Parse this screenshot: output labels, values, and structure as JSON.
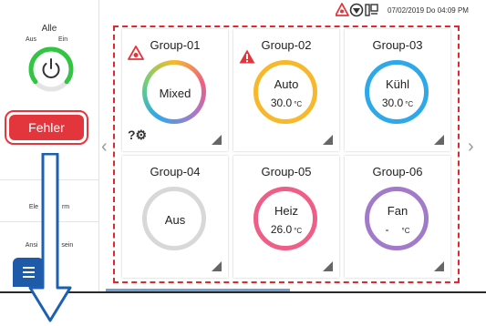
{
  "sidebar": {
    "title": "Alle",
    "off_label": "Aus",
    "on_label": "Ein",
    "error_button": "Fehler",
    "item1": "Ele",
    "item1_tail": "rm",
    "item2": "Ansi",
    "item2_tail": "sein"
  },
  "header": {
    "datetime": "07/02/2019 Do 04:09 PM"
  },
  "groups": [
    {
      "name": "Group-01",
      "mode": "Mixed",
      "temp": "",
      "unit": "",
      "error": true
    },
    {
      "name": "Group-02",
      "mode": "Auto",
      "temp": "30.0",
      "unit": "°C",
      "error": true
    },
    {
      "name": "Group-03",
      "mode": "Kühl",
      "temp": "30.0",
      "unit": "°C",
      "error": false
    },
    {
      "name": "Group-04",
      "mode": "Aus",
      "temp": "",
      "unit": "",
      "error": false
    },
    {
      "name": "Group-05",
      "mode": "Heiz",
      "temp": "26.0",
      "unit": "°C",
      "error": false
    },
    {
      "name": "Group-06",
      "mode": "Fan",
      "temp": "-",
      "unit": "°C",
      "error": false
    }
  ],
  "help_glyph": "?⚙",
  "nav": {
    "prev": "‹",
    "next": "›"
  },
  "colors": {
    "error_red": "#e3363c",
    "auto_ring": "#f7b92b",
    "cool_ring": "#2fa8ea",
    "off_ring": "#d8d8d8",
    "heat_ring": "#ef5e86",
    "fan_ring": "#a17bc9",
    "menu_blue": "#1f5aa8",
    "power_green": "#33c443"
  }
}
